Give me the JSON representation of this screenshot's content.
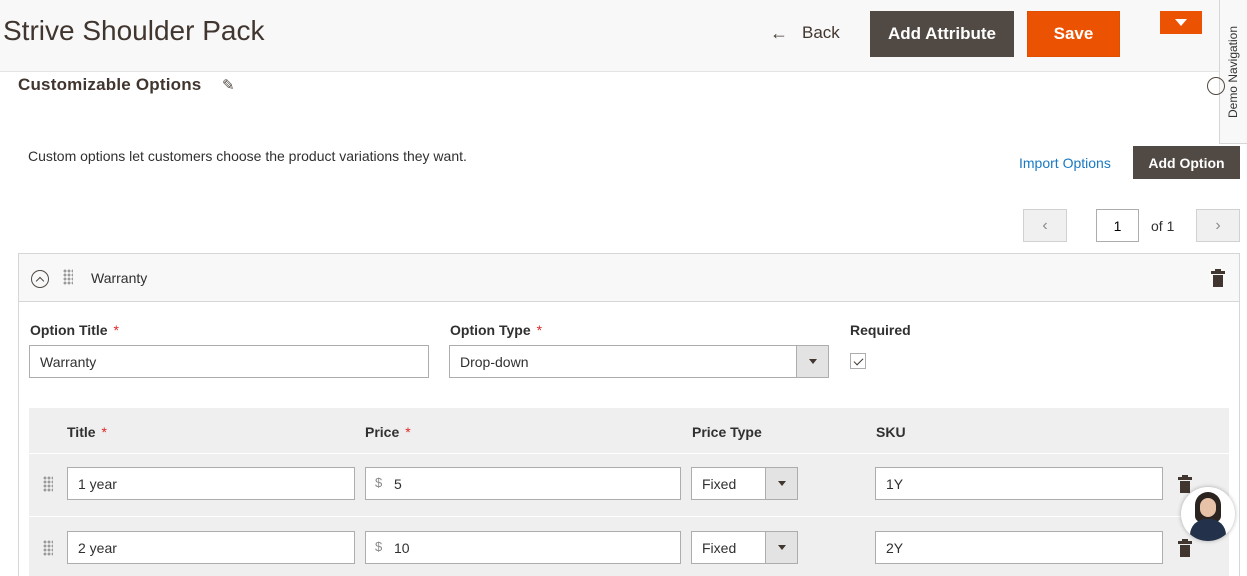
{
  "header": {
    "title": "Strive Shoulder Pack",
    "back_label": "Back",
    "add_attribute_label": "Add Attribute",
    "save_label": "Save"
  },
  "demo_nav_label": "Demo Navigation",
  "section": {
    "title": "Customizable Options",
    "description": "Custom options let customers choose the product variations they want.",
    "import_label": "Import Options",
    "add_option_label": "Add Option"
  },
  "pager": {
    "current": "1",
    "of_label": "of 1"
  },
  "option": {
    "name": "Warranty",
    "title_label": "Option Title",
    "title_value": "Warranty",
    "type_label": "Option Type",
    "type_value": "Drop-down",
    "required_label": "Required",
    "required_checked": true
  },
  "values_table": {
    "headers": {
      "title": "Title",
      "price": "Price",
      "price_type": "Price Type",
      "sku": "SKU"
    },
    "currency": "$",
    "rows": [
      {
        "title": "1 year",
        "price": "5",
        "price_type": "Fixed",
        "sku": "1Y"
      },
      {
        "title": "2 year",
        "price": "10",
        "price_type": "Fixed",
        "sku": "2Y"
      }
    ]
  },
  "colors": {
    "accent": "#eb5202",
    "dark_button": "#514943",
    "link": "#1979c3",
    "required_star": "#e22626"
  }
}
